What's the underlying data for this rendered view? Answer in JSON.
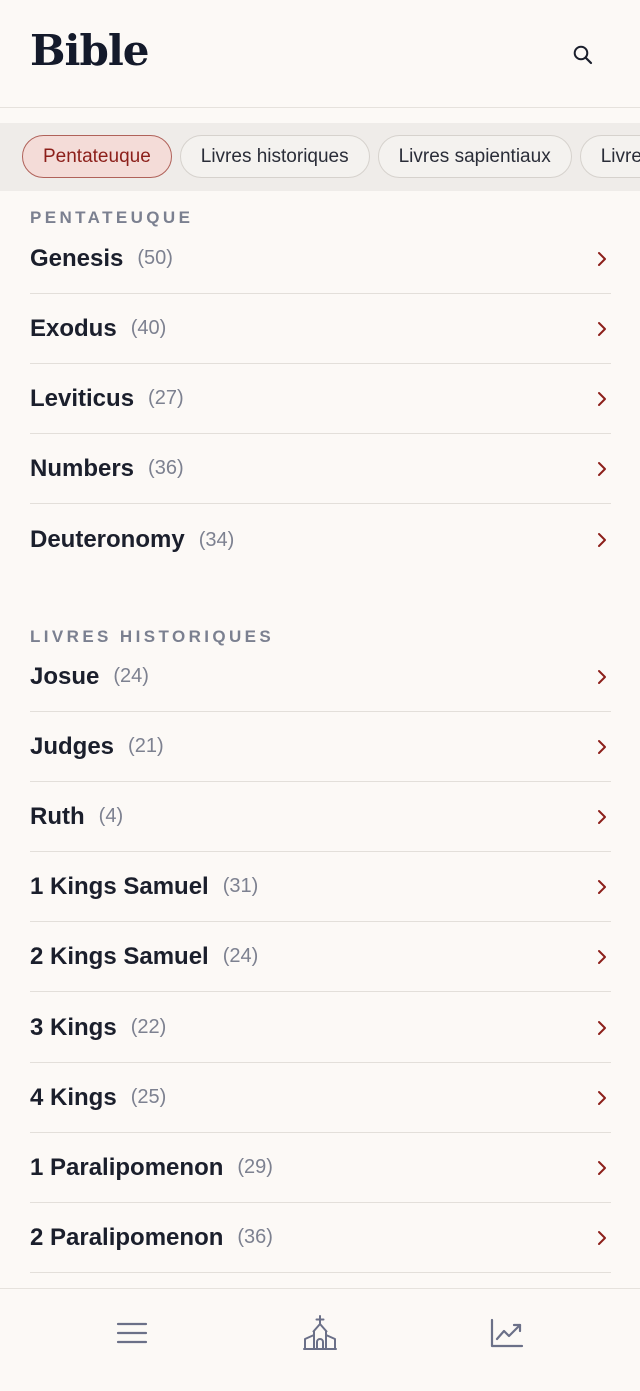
{
  "header": {
    "title": "Bible",
    "search_icon": "search-icon"
  },
  "categories": [
    "Pentateuque",
    "Livres historiques",
    "Livres sapientiaux",
    "Livres prophétiques"
  ],
  "active_category": "Pentateuque",
  "sections": [
    {
      "title": "PENTATEUQUE",
      "books": [
        {
          "name": "Genesis",
          "count": "(50)"
        },
        {
          "name": "Exodus",
          "count": "(40)"
        },
        {
          "name": "Leviticus",
          "count": "(27)"
        },
        {
          "name": "Numbers",
          "count": "(36)"
        },
        {
          "name": "Deuteronomy",
          "count": "(34)"
        }
      ]
    },
    {
      "title": "LIVRES HISTORIQUES",
      "books": [
        {
          "name": "Josue",
          "count": "(24)"
        },
        {
          "name": "Judges",
          "count": "(21)"
        },
        {
          "name": "Ruth",
          "count": "(4)"
        },
        {
          "name": "1 Kings Samuel",
          "count": "(31)"
        },
        {
          "name": "2 Kings Samuel",
          "count": "(24)"
        },
        {
          "name": "3 Kings",
          "count": "(22)"
        },
        {
          "name": "4 Kings",
          "count": "(25)"
        },
        {
          "name": "1 Paralipomenon",
          "count": "(29)"
        },
        {
          "name": "2 Paralipomenon",
          "count": "(36)"
        }
      ]
    }
  ],
  "tabbar": {
    "icons": [
      "menu-icon",
      "church-icon",
      "chart-trend-icon"
    ]
  },
  "colors": {
    "accent": "#8c1f1a",
    "background": "#fcf9f6",
    "chip_active_bg": "#f4dcd8"
  }
}
